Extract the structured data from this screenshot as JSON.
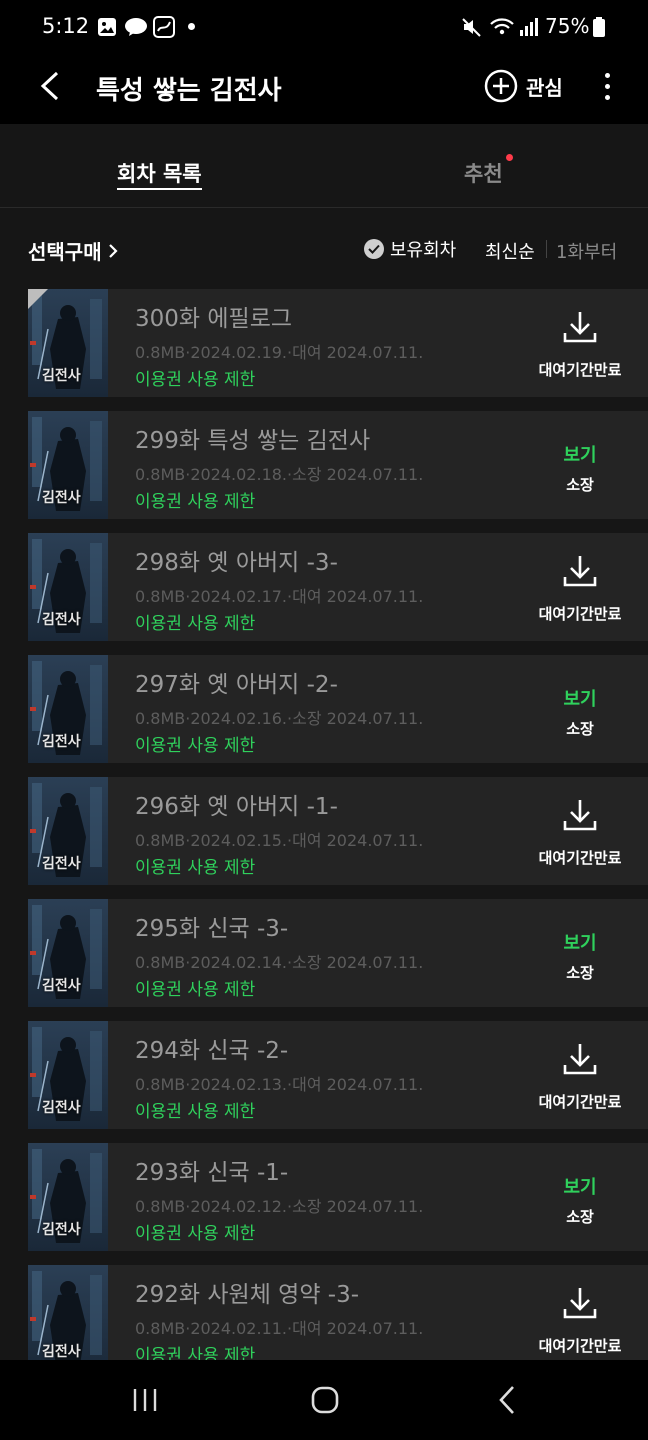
{
  "status_bar": {
    "time": "5:12",
    "battery": "75%",
    "talk_badge": "TALK"
  },
  "header": {
    "title": "특성 쌓는 김전사",
    "favorite_label": "관심"
  },
  "tabs": [
    {
      "label": "회차 목록",
      "active": true
    },
    {
      "label": "추천",
      "active": false,
      "has_new_dot": true
    }
  ],
  "filter": {
    "select_buy": "선택구매",
    "owned_only": "보유회차",
    "sort_latest": "최신순",
    "sort_first": "1화부터"
  },
  "thumbnail_text": "김전사",
  "episodes": [
    {
      "title": "300화 에필로그",
      "meta": "0.8MB·2024.02.19.·대여 2024.07.11.",
      "restriction": "이용권 사용 제한",
      "action": "download",
      "action_label": "대여기간만료"
    },
    {
      "title": "299화 특성 쌓는 김전사",
      "meta": "0.8MB·2024.02.18.·소장 2024.07.11.",
      "restriction": "이용권 사용 제한",
      "action": "view",
      "action_label": "보기",
      "action_sub": "소장"
    },
    {
      "title": "298화 옛 아버지 -3-",
      "meta": "0.8MB·2024.02.17.·대여 2024.07.11.",
      "restriction": "이용권 사용 제한",
      "action": "download",
      "action_label": "대여기간만료"
    },
    {
      "title": "297화 옛 아버지 -2-",
      "meta": "0.8MB·2024.02.16.·소장 2024.07.11.",
      "restriction": "이용권 사용 제한",
      "action": "view",
      "action_label": "보기",
      "action_sub": "소장"
    },
    {
      "title": "296화 옛 아버지 -1-",
      "meta": "0.8MB·2024.02.15.·대여 2024.07.11.",
      "restriction": "이용권 사용 제한",
      "action": "download",
      "action_label": "대여기간만료"
    },
    {
      "title": "295화 신국 -3-",
      "meta": "0.8MB·2024.02.14.·소장 2024.07.11.",
      "restriction": "이용권 사용 제한",
      "action": "view",
      "action_label": "보기",
      "action_sub": "소장"
    },
    {
      "title": "294화 신국 -2-",
      "meta": "0.8MB·2024.02.13.·대여 2024.07.11.",
      "restriction": "이용권 사용 제한",
      "action": "download",
      "action_label": "대여기간만료"
    },
    {
      "title": "293화 신국 -1-",
      "meta": "0.8MB·2024.02.12.·소장 2024.07.11.",
      "restriction": "이용권 사용 제한",
      "action": "view",
      "action_label": "보기",
      "action_sub": "소장"
    },
    {
      "title": "292화 사원체 영약 -3-",
      "meta": "0.8MB·2024.02.11.·대여 2024.07.11.",
      "restriction": "이용권 사용 제한",
      "action": "download",
      "action_label": "대여기간만료"
    }
  ],
  "colors": {
    "accent_green": "#2fd15c",
    "background": "#161616",
    "row_background": "#242424"
  }
}
